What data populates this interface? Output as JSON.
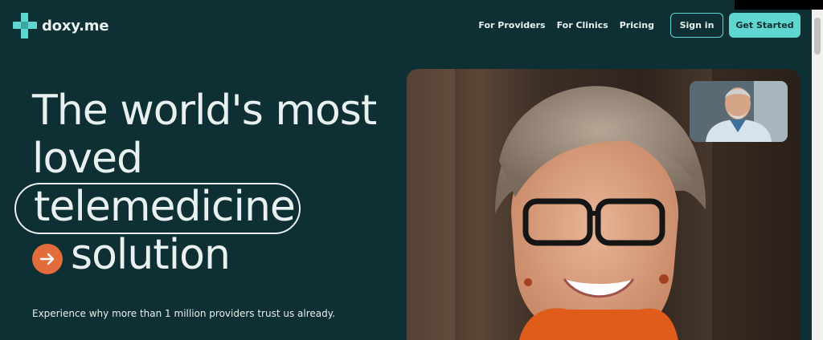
{
  "logo": {
    "text": "doxy.me",
    "icon": "cross-logo-icon",
    "color": "#5fd6cf"
  },
  "nav": {
    "links": [
      "For Providers",
      "For Clinics",
      "Pricing"
    ],
    "sign_in": "Sign in",
    "get_started": "Get Started"
  },
  "hero": {
    "line1": "The world's most",
    "line2": "loved",
    "line3": "telemedicine",
    "line4": "solution",
    "arrow_icon": "arrow-right-icon",
    "subtext": "Experience why more than 1 million providers trust us already."
  },
  "media": {
    "main_photo": "smiling-woman-with-glasses-photo",
    "pip_photo": "doctor-video-thumbnail"
  },
  "colors": {
    "background": "#0e2f33",
    "accent": "#5fd6cf",
    "arrow": "#e36d3a",
    "text": "#e8f1ef"
  }
}
